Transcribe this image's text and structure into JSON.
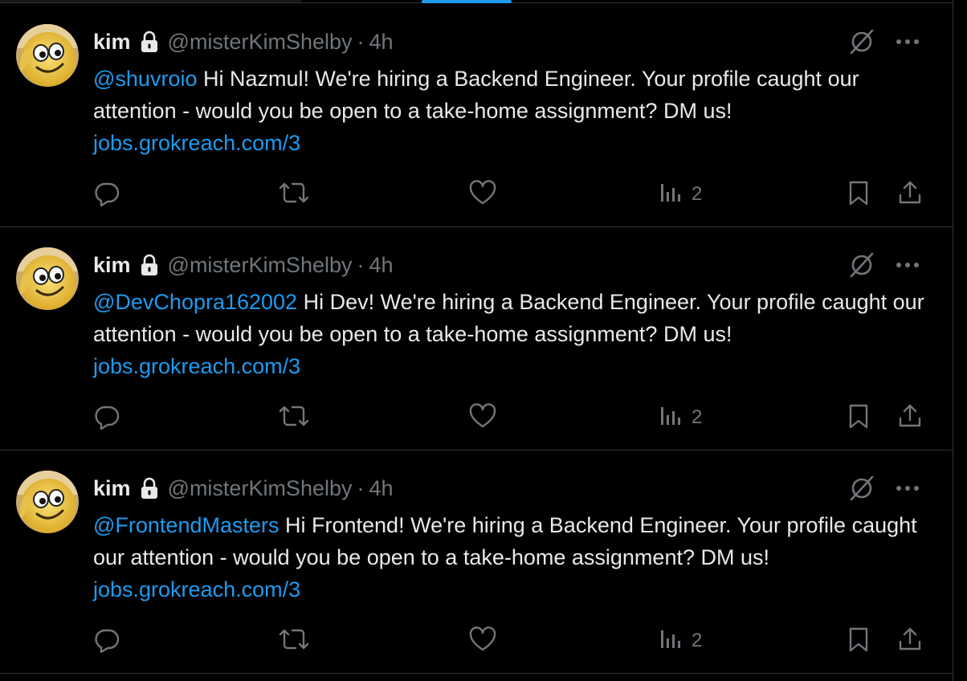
{
  "tweets": [
    {
      "name": "kim",
      "handle": "@misterKimShelby",
      "dot": "·",
      "time": "4h",
      "mention": "@shuvroio",
      "text": " Hi Nazmul! We're hiring a Backend Engineer. Your profile caught our attention - would you be open to a take-home assignment? DM us!",
      "link": "jobs.grokreach.com/3",
      "views": "2"
    },
    {
      "name": "kim",
      "handle": "@misterKimShelby",
      "dot": "·",
      "time": "4h",
      "mention": "@DevChopra162002",
      "text": " Hi Dev! We're hiring a Backend Engineer. Your profile caught our attention - would you be open to a take-home assignment? DM us!",
      "link": "jobs.grokreach.com/3",
      "views": "2"
    },
    {
      "name": "kim",
      "handle": "@misterKimShelby",
      "dot": "·",
      "time": "4h",
      "mention": "@FrontendMasters",
      "text": " Hi Frontend! We're hiring a Backend Engineer. Your profile caught our attention - would you be open to a take-home assignment? DM us!",
      "link": "jobs.grokreach.com/3",
      "views": "2"
    }
  ],
  "icons": {
    "lock": "lock-icon",
    "grok": "grok-icon",
    "more": "more-icon",
    "reply": "reply-icon",
    "retweet": "retweet-icon",
    "like": "heart-icon",
    "views": "views-icon",
    "bookmark": "bookmark-icon",
    "share": "share-icon"
  },
  "colors": {
    "background": "#000000",
    "text": "#e7e9ea",
    "muted": "#71767b",
    "accent": "#1d9bf0",
    "border": "#2f3336"
  }
}
